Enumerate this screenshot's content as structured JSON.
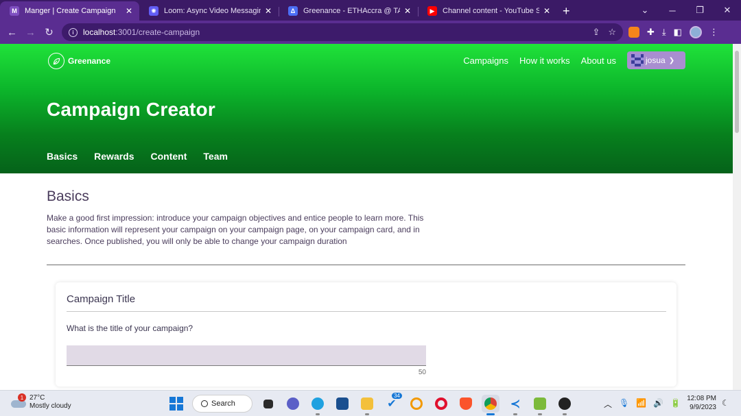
{
  "browser": {
    "tabs": [
      {
        "title": "Manger | Create Campaign",
        "favicon": "M",
        "color": "#5a2d91",
        "active": true
      },
      {
        "title": "Loom: Async Video Messaging fo",
        "favicon": "✺",
        "color": "#625df5",
        "active": false
      },
      {
        "title": "Greenance - ETHAccra @ TAIKAI",
        "favicon": "Δ",
        "color": "#4c6ef5",
        "active": false
      },
      {
        "title": "Channel content - YouTube Studi",
        "favicon": "▶",
        "color": "#ff0000",
        "active": false
      }
    ],
    "new_tab": "+",
    "url_host": "localhost",
    "url_path": ":3001/create-campaign"
  },
  "site": {
    "brand": "Greenance",
    "nav": [
      "Campaigns",
      "How it works",
      "About us"
    ],
    "user": "josua"
  },
  "hero": {
    "title": "Campaign Creator",
    "tabs": [
      "Basics",
      "Rewards",
      "Content",
      "Team"
    ],
    "active_tab": "Basics"
  },
  "basics": {
    "title": "Basics",
    "description": "Make a good first impression: introduce your campaign objectives and entice people to learn more. This basic information will represent your campaign on your campaign page, on your campaign card, and in searches. Once published, you will only be able to change your campaign duration"
  },
  "campaign_title_card": {
    "title": "Campaign Title",
    "question": "What is the title of your campaign?",
    "value": "",
    "char_limit": "50"
  },
  "taskbar": {
    "weather_badge": "1",
    "temperature": "27°C",
    "weather": "Mostly cloudy",
    "search_label": "Search",
    "teams_badge": "34",
    "time": "12:08 PM",
    "date": "9/9/2023"
  },
  "colors": {
    "browser_frame": "#5a2d91",
    "hero_green": "#0cb62b",
    "user_button": "#a98ed0"
  }
}
